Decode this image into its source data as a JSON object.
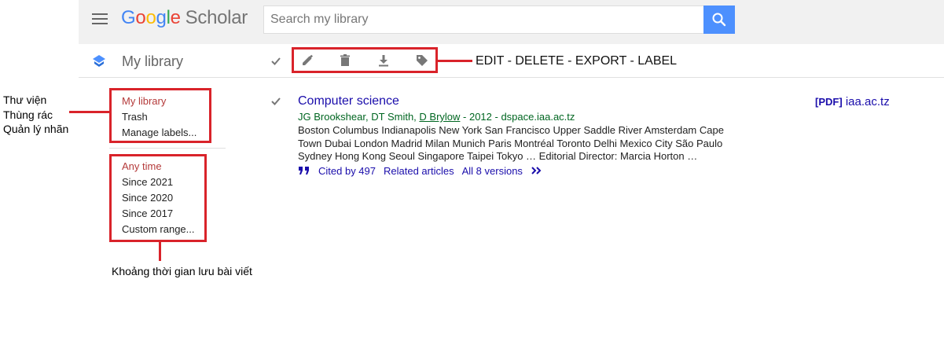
{
  "header": {
    "logo_google": "Google",
    "logo_scholar": "Scholar",
    "search_placeholder": "Search my library"
  },
  "library_bar": {
    "title": "My library",
    "toolbar_annotation": "EDIT - DELETE - EXPORT - LABEL",
    "tools": [
      "edit-icon",
      "delete-icon",
      "export-icon",
      "label-icon"
    ]
  },
  "sidebar": {
    "library_items": [
      "My library",
      "Trash",
      "Manage labels..."
    ],
    "time_items": [
      "Any time",
      "Since 2021",
      "Since 2020",
      "Since 2017",
      "Custom range..."
    ]
  },
  "annotations": {
    "left_lines": [
      "Thư viện",
      "Thùng rác",
      "Quản lý nhãn"
    ],
    "time_note": "Khoảng thời gian lưu bài viết"
  },
  "result": {
    "title": "Computer science",
    "authors": [
      "JG Brookshear",
      "DT Smith",
      "D Brylow"
    ],
    "year_source": " - 2012 - dspace.iaa.ac.tz",
    "snippet": "Boston Columbus Indianapolis New York San Francisco Upper Saddle River Amsterdam Cape Town Dubai London Madrid Milan Munich Paris Montréal Toronto Delhi Mexico City São Paulo Sydney Hong Kong Seoul Singapore Taipei Tokyo … Editorial Director: Marcia Horton …",
    "cited_by": "Cited by 497",
    "related": "Related articles",
    "versions": "All 8 versions",
    "pdf_tag": "[PDF]",
    "pdf_domain": "iaa.ac.tz"
  },
  "colors": {
    "annotation_red": "#d9232a",
    "link_blue": "#1a0dab",
    "author_green": "#006621",
    "search_button": "#4d90fe"
  }
}
